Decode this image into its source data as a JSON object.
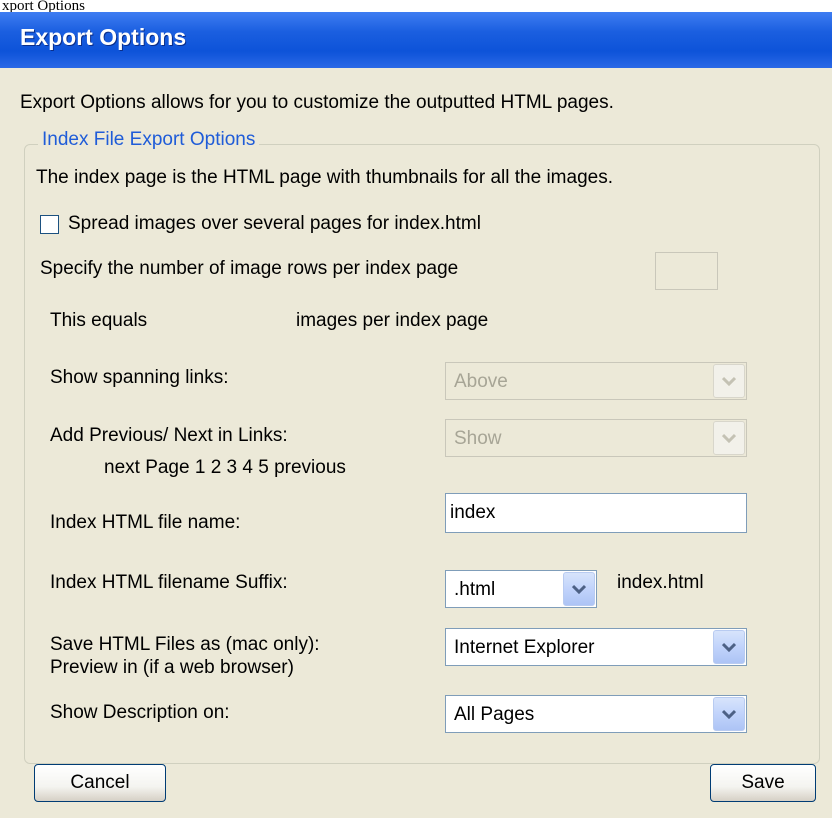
{
  "window": {
    "caption_fragment": "xport Options"
  },
  "dialog": {
    "title": "Export Options",
    "intro": "Export Options allows for you to customize the outputted HTML pages."
  },
  "group": {
    "legend": "Index File Export Options",
    "description": "The index page is the HTML page with thumbnails for all the images.",
    "spread_checkbox": {
      "label": "Spread images over several pages for index.html",
      "checked": false
    },
    "rows_label": "Specify the number of image rows per index page",
    "rows_value": "",
    "equals_label": "This equals",
    "equals_suffix": "images per index page",
    "spanning": {
      "label": "Show spanning links:",
      "value": "Above",
      "enabled": false
    },
    "prevnext": {
      "label": "Add Previous/ Next in Links:",
      "example": "next  Page 1 2 3 4 5 previous",
      "value": "Show",
      "enabled": false
    },
    "filename": {
      "label": "Index HTML file name:",
      "value": "index"
    },
    "suffix": {
      "label": "Index HTML filename Suffix:",
      "value": ".html",
      "preview": "index.html"
    },
    "save_as": {
      "label": "Save HTML Files as (mac only):",
      "label2": "Preview in (if a web browser)",
      "value": "Internet Explorer"
    },
    "description_on": {
      "label": "Show Description on:",
      "value": "All Pages"
    }
  },
  "buttons": {
    "cancel": "Cancel",
    "save": "Save"
  },
  "colors": {
    "titlebar": "#0d53d9",
    "dialog_bg": "#ece9d8",
    "legend": "#1f5cd8"
  }
}
